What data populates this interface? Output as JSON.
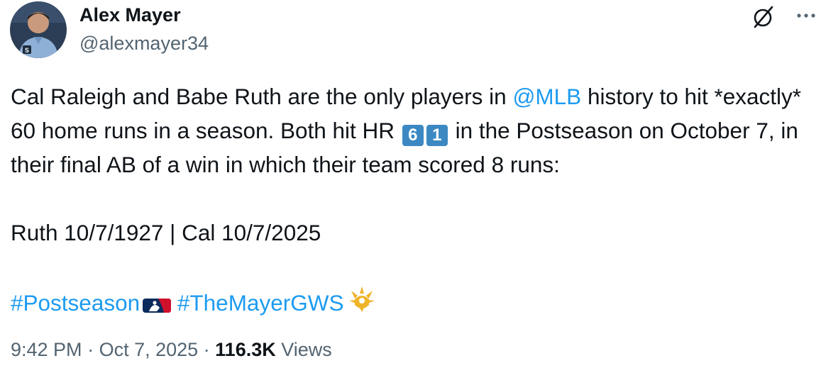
{
  "author": {
    "display_name": "Alex Mayer",
    "handle": "@alexmayer34",
    "avatar_icon": "profile-photo"
  },
  "header_icons": [
    "grok-icon",
    "more-options-icon"
  ],
  "tweet": {
    "line1_start": "Cal Raleigh and Babe Ruth are the only players in ",
    "mention": "@MLB",
    "line1_end": " history to hit *exactly* 60 home runs in a season. Both hit HR ",
    "keycap_1": "6",
    "keycap_2": "1",
    "line1_tail": " in the Postseason on October 7, in their final AB of a win in which their team scored 8 runs:",
    "dates": "Ruth 10/7/1927 | Cal 10/7/2025",
    "hashtag_1": "#Postseason",
    "hashtag_2": "#TheMayerGWS"
  },
  "meta": {
    "time": "9:42 PM",
    "separator_1": " · ",
    "date": "Oct 7, 2025",
    "separator_2": " · ",
    "views_count": "116.3K",
    "views_label": " Views"
  },
  "colors": {
    "link": "#1d9bf0",
    "text": "#0f1419",
    "secondary": "#536471",
    "keycap": "#3b88c3"
  }
}
